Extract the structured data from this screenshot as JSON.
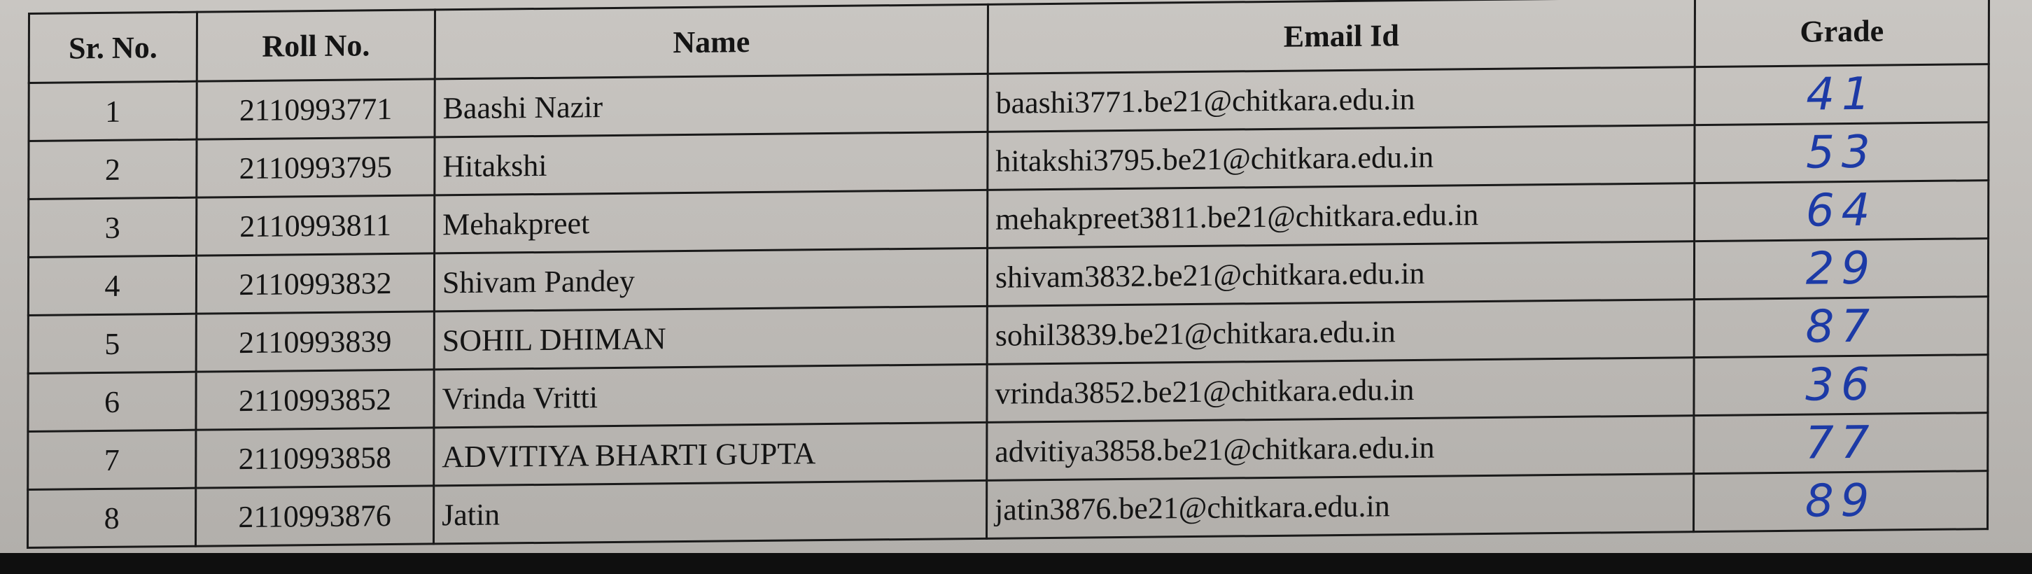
{
  "table": {
    "headers": {
      "sr_no": "Sr. No.",
      "roll_no": "Roll No.",
      "name": "Name",
      "email": "Email Id",
      "grade": "Grade"
    },
    "rows": [
      {
        "sr_no": "1",
        "roll_no": "2110993771",
        "name": "Baashi Nazir",
        "email": "baashi3771.be21@chitkara.edu.in",
        "grade": "41"
      },
      {
        "sr_no": "2",
        "roll_no": "2110993795",
        "name": "Hitakshi",
        "email": "hitakshi3795.be21@chitkara.edu.in",
        "grade": "53"
      },
      {
        "sr_no": "3",
        "roll_no": "2110993811",
        "name": "Mehakpreet",
        "email": "mehakpreet3811.be21@chitkara.edu.in",
        "grade": "64"
      },
      {
        "sr_no": "4",
        "roll_no": "2110993832",
        "name": "Shivam Pandey",
        "email": "shivam3832.be21@chitkara.edu.in",
        "grade": "29"
      },
      {
        "sr_no": "5",
        "roll_no": "2110993839",
        "name": "SOHIL DHIMAN",
        "email": "sohil3839.be21@chitkara.edu.in",
        "grade": "87"
      },
      {
        "sr_no": "6",
        "roll_no": "2110993852",
        "name": "Vrinda Vritti",
        "email": "vrinda3852.be21@chitkara.edu.in",
        "grade": "36"
      },
      {
        "sr_no": "7",
        "roll_no": "2110993858",
        "name": "ADVITIYA BHARTI GUPTA",
        "email": "advitiya3858.be21@chitkara.edu.in",
        "grade": "77"
      },
      {
        "sr_no": "8",
        "roll_no": "2110993876",
        "name": "Jatin",
        "email": "jatin3876.be21@chitkara.edu.in",
        "grade": "89"
      }
    ]
  },
  "colors": {
    "paper": "#c5c2be",
    "ink": "#141414",
    "handwriting": "#1c3aa6",
    "background": "#161616"
  }
}
